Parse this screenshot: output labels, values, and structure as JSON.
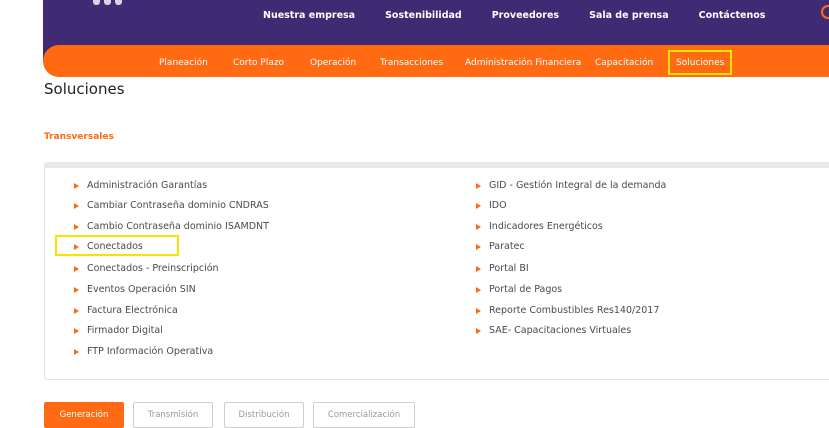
{
  "top_nav": [
    "Nuestra empresa",
    "Sostenibilidad",
    "Proveedores",
    "Sala de prensa",
    "Contáctenos"
  ],
  "main_nav": [
    "Planeación",
    "Corto Plazo",
    "Operación",
    "Transacciones",
    "Administración Financiera",
    "Capacitación",
    "Soluciones"
  ],
  "page_title": "Soluciones",
  "section_title": "Transversales",
  "links_left": [
    "Administración Garantías",
    "Cambiar Contraseña dominio CNDRAS",
    "Cambio Contraseña dominio ISAMDNT",
    "Conectados",
    "Conectados - Preinscripción",
    "Eventos Operación SIN",
    "Factura Electrónica",
    "Firmador Digital",
    "FTP Información Operativa"
  ],
  "links_right": [
    "GID - Gestión Integral de la demanda",
    "IDO",
    "Indicadores Energéticos",
    "Paratec",
    "Portal BI",
    "Portal de Pagos",
    "Reporte Combustibles Res140/2017",
    "SAE- Capacitaciones Virtuales"
  ],
  "tabs": [
    "Generación",
    "Transmisión",
    "Distribución",
    "Comercialización"
  ],
  "colors": {
    "purple": "#3f2b73",
    "orange": "#ff6a13",
    "highlight": "#f4e400"
  }
}
